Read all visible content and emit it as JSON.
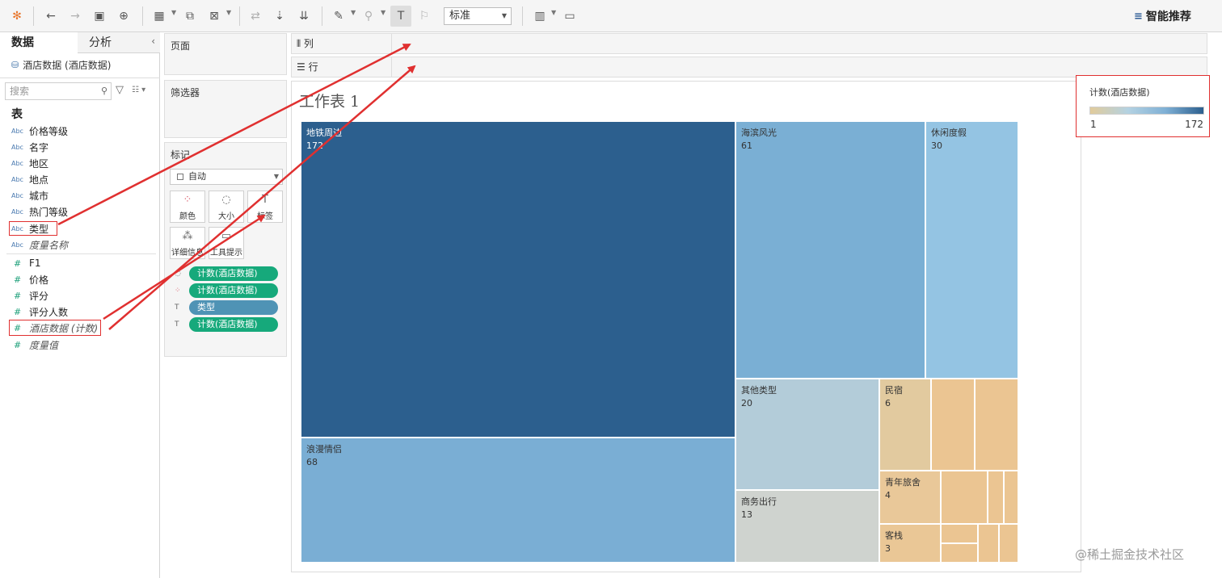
{
  "toolbar": {
    "icons": [
      "tableau-logo-icon",
      "undo-icon",
      "redo-icon",
      "save-icon",
      "new-datasource-icon",
      "new-sheet-icon",
      "duplicate-icon",
      "clear-sheet-icon",
      "swap-icon",
      "sort-asc-icon",
      "sort-desc-icon",
      "highlight-icon",
      "group-icon",
      "show-labels-icon",
      "fix-axes-icon",
      "show-me-icon",
      "presentation-icon"
    ],
    "fit_value": "标准",
    "smart_recommend": "智能推荐"
  },
  "data_pane": {
    "tab_data": "数据",
    "tab_analysis": "分析",
    "datasource": "酒店数据 (酒店数据)",
    "search_placeholder": "搜索",
    "section_table": "表",
    "dimensions": [
      {
        "type": "Abc",
        "name": "价格等级"
      },
      {
        "type": "Abc",
        "name": "名字"
      },
      {
        "type": "Abc",
        "name": "地区"
      },
      {
        "type": "Abc",
        "name": "地点"
      },
      {
        "type": "Abc",
        "name": "城市"
      },
      {
        "type": "Abc",
        "name": "热门等级"
      },
      {
        "type": "Abc",
        "name": "类型"
      },
      {
        "type": "Abc",
        "name": "度量名称"
      }
    ],
    "measures": [
      {
        "type": "#",
        "name": "F1"
      },
      {
        "type": "#",
        "name": "价格"
      },
      {
        "type": "#",
        "name": "评分"
      },
      {
        "type": "#",
        "name": "评分人数"
      },
      {
        "type": "#",
        "name": "酒店数据 (计数)"
      },
      {
        "type": "#",
        "name": "度量值"
      }
    ]
  },
  "cards": {
    "pages": "页面",
    "filters": "筛选器",
    "marks": "标记",
    "mark_type": "自动",
    "buttons": [
      {
        "label": "颜色",
        "icon": "color-icon"
      },
      {
        "label": "大小",
        "icon": "size-icon"
      },
      {
        "label": "标签",
        "icon": "label-icon"
      },
      {
        "label": "详细信息",
        "icon": "detail-icon"
      },
      {
        "label": "工具提示",
        "icon": "tooltip-icon"
      }
    ],
    "pills": [
      {
        "icon": "size-icon",
        "label": "计数(酒店数据)",
        "color": "#16a97b"
      },
      {
        "icon": "color-icon",
        "label": "计数(酒店数据)",
        "color": "#16a97b"
      },
      {
        "icon": "label-icon",
        "label": "类型",
        "color": "#4f93b5"
      },
      {
        "icon": "label-icon",
        "label": "计数(酒店数据)",
        "color": "#16a97b"
      }
    ]
  },
  "shelves": {
    "columns": "列",
    "rows": "行"
  },
  "view": {
    "sheet_title": "工作表 1"
  },
  "legend": {
    "title": "计数(酒店数据)",
    "min": "1",
    "max": "172"
  },
  "watermark": "@稀土掘金技术社区",
  "chart_data": {
    "type": "treemap",
    "size_and_color_by": "计数(酒店数据)",
    "color_range": [
      1,
      172
    ],
    "tiles": [
      {
        "category": "地铁周边",
        "value": 172
      },
      {
        "category": "浪漫情侣",
        "value": 68
      },
      {
        "category": "海滨风光",
        "value": 61
      },
      {
        "category": "休闲度假",
        "value": 30
      },
      {
        "category": "其他类型",
        "value": 20
      },
      {
        "category": "商务出行",
        "value": 13
      },
      {
        "category": "民宿",
        "value": 6
      },
      {
        "category": "青年旅舍",
        "value": 4
      },
      {
        "category": "客栈",
        "value": 3
      }
    ]
  }
}
